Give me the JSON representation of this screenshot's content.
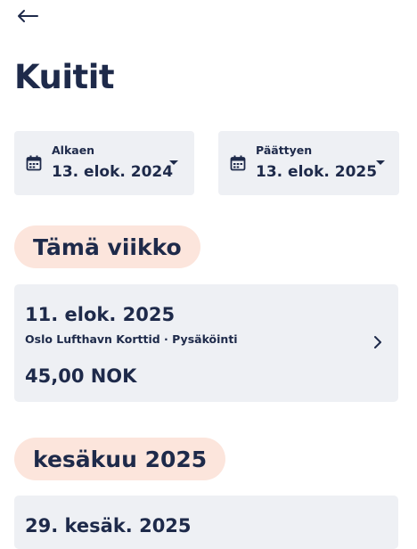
{
  "header": {
    "back_icon": "arrow-left-icon",
    "title": "Kuitit"
  },
  "filters": {
    "from": {
      "label": "Alkaen",
      "value": "13. elok. 2024",
      "icon": "calendar-icon"
    },
    "to": {
      "label": "Päättyen",
      "value": "13. elok. 2025",
      "icon": "calendar-icon"
    }
  },
  "sections": [
    {
      "heading": "Tämä viikko",
      "receipts": [
        {
          "date": "11. elok. 2025",
          "merchant": "Oslo Lufthavn Korttid",
          "category": "Pysäköinti",
          "amount": "45,00 NOK"
        }
      ]
    },
    {
      "heading": "kesäkuu 2025",
      "receipts": [
        {
          "date": "29. kesäk. 2025"
        }
      ]
    }
  ],
  "colors": {
    "text": "#1e2a4a",
    "card_background": "#eef0f4",
    "pill_background": "#fce5dc"
  }
}
